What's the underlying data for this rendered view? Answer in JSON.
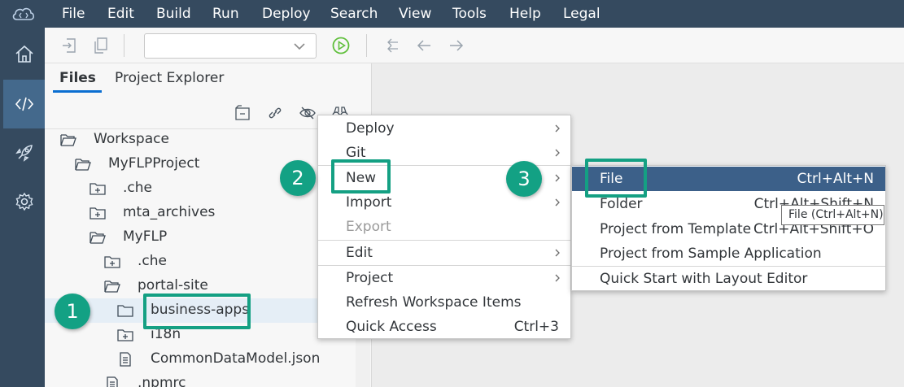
{
  "menu_bar": {
    "items": [
      "File",
      "Edit",
      "Build",
      "Run",
      "Deploy",
      "Search",
      "View",
      "Tools",
      "Help",
      "Legal"
    ]
  },
  "side_rail": {
    "items": [
      {
        "icon": "home-icon"
      },
      {
        "icon": "code-icon",
        "active": true
      },
      {
        "icon": "rocket-icon"
      },
      {
        "icon": "settings-gear-icon"
      }
    ]
  },
  "toolbar": {
    "run_config_value": ""
  },
  "files_panel": {
    "tabs": [
      "Files",
      "Project Explorer"
    ],
    "active_tab": "Files",
    "tree": [
      {
        "label": "Workspace",
        "icon": "folder-open-icon"
      },
      {
        "label": "MyFLPProject",
        "icon": "folder-open-icon"
      },
      {
        "label": ".che",
        "icon": "folder-plus-icon"
      },
      {
        "label": "mta_archives",
        "icon": "folder-plus-icon"
      },
      {
        "label": "MyFLP",
        "icon": "folder-open-icon"
      },
      {
        "label": ".che",
        "icon": "folder-plus-icon"
      },
      {
        "label": "portal-site",
        "icon": "folder-open-icon"
      },
      {
        "label": "business-apps",
        "icon": "folder-icon",
        "selected": true
      },
      {
        "label": "i18n",
        "icon": "folder-plus-icon"
      },
      {
        "label": "CommonDataModel.json",
        "icon": "file-icon"
      },
      {
        "label": ".npmrc",
        "icon": "file-icon"
      }
    ]
  },
  "context_menu": {
    "items": [
      {
        "label": "Deploy",
        "submenu": true
      },
      {
        "label": "Git",
        "submenu": true
      },
      {
        "label": "New",
        "submenu": true
      },
      {
        "label": "Import",
        "submenu": true
      },
      {
        "label": "Export",
        "disabled": true
      },
      {
        "label": "Edit",
        "submenu": true
      },
      {
        "label": "Project",
        "submenu": true
      },
      {
        "label": "Refresh Workspace Items"
      },
      {
        "label": "Quick Access",
        "shortcut": "Ctrl+3"
      }
    ]
  },
  "new_submenu": {
    "items": [
      {
        "label": "File",
        "shortcut": "Ctrl+Alt+N",
        "highlighted": true
      },
      {
        "label": "Folder",
        "shortcut": "Ctrl+Alt+Shift+N"
      },
      {
        "label": "Project from Template",
        "shortcut": "Ctrl+Alt+Shift+O"
      },
      {
        "label": "Project from Sample Application",
        "shortcut": ""
      },
      {
        "label": "Quick Start with Layout Editor",
        "shortcut": ""
      }
    ]
  },
  "tooltip": {
    "text": "File (Ctrl+Alt+N)"
  },
  "callouts": [
    {
      "number": "1",
      "target": "business-apps"
    },
    {
      "number": "2",
      "target": "New"
    },
    {
      "number": "3",
      "target": "File"
    }
  ],
  "colors": {
    "shell": "#354a5f",
    "rail_active": "#44698c",
    "accent": "#0a6ed1",
    "callout": "#14a083",
    "menu_highlight": "#3c6089"
  }
}
